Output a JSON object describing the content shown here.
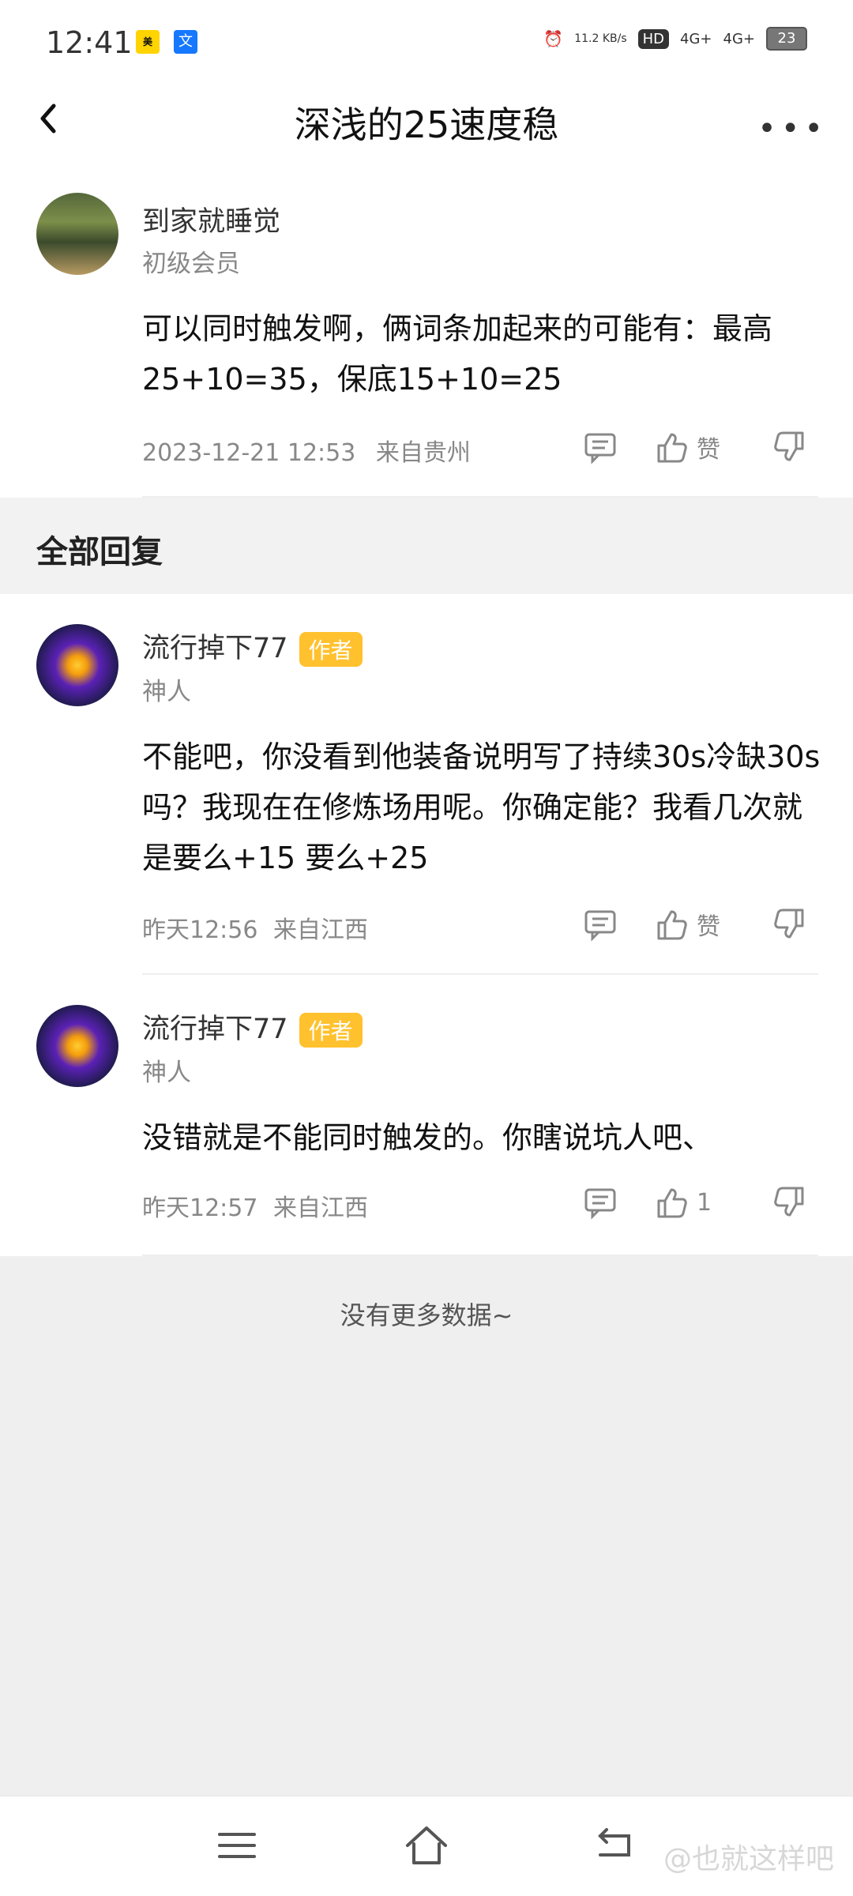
{
  "status_bar": {
    "time": "12:41",
    "net_speed": "11.2\nKB/s",
    "hd": "HD",
    "signal1": "4G+",
    "signal2": "4G+",
    "battery": "23"
  },
  "header": {
    "title": "深浅的25速度稳"
  },
  "post": {
    "user": "到家就睡觉",
    "level": "初级会员",
    "content": "可以同时触发啊，俩词条加起来的可能有：最高25+10=35，保底15+10=25",
    "time": "2023-12-21 12:53",
    "location": "来自贵州",
    "like_label": "赞"
  },
  "section": {
    "title": "全部回复"
  },
  "replies": [
    {
      "user": "流行掉下77",
      "badge": "作者",
      "level": "神人",
      "content": "不能吧，你没看到他装备说明写了持续30s冷缺30s吗？我现在在修炼场用呢。你确定能？我看几次就是要么+15 要么+25",
      "time": "昨天12:56",
      "location": "来自江西",
      "like_label": "赞"
    },
    {
      "user": "流行掉下77",
      "badge": "作者",
      "level": "神人",
      "content": "没错就是不能同时触发的。你瞎说坑人吧、",
      "time": "昨天12:57",
      "location": "来自江西",
      "like_label": "1"
    }
  ],
  "footer": {
    "no_more": "没有更多数据~"
  },
  "watermark": "@也就这样吧"
}
